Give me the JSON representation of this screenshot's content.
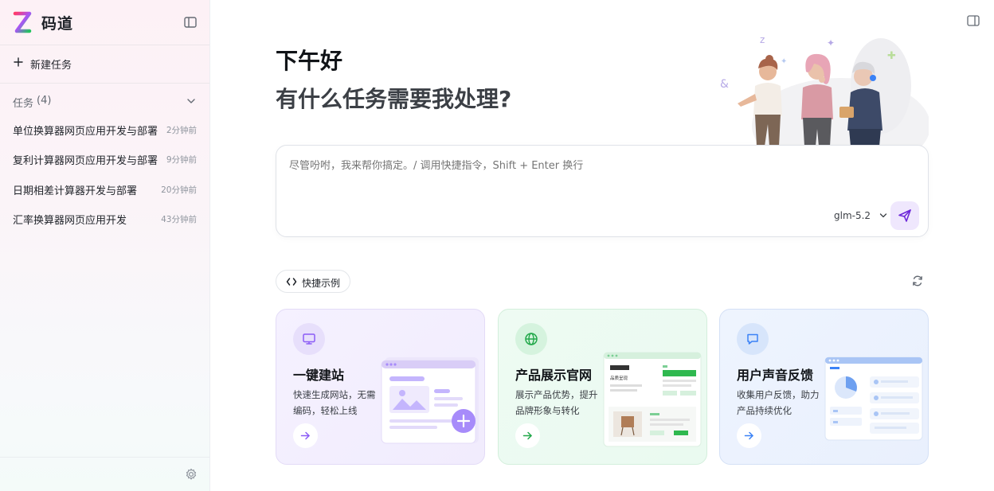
{
  "app": {
    "title": "码道"
  },
  "sidebar": {
    "new_task_label": "新建任务",
    "tasks_label": "任务",
    "tasks_count": "(4)",
    "tasks": [
      {
        "name": "单位换算器网页应用开发与部署",
        "time": "2分钟前"
      },
      {
        "name": "复利计算器网页应用开发与部署",
        "time": "9分钟前"
      },
      {
        "name": "日期相差计算器开发与部署",
        "time": "20分钟前"
      },
      {
        "name": "汇率换算器网页应用开发",
        "time": "43分钟前"
      }
    ]
  },
  "main": {
    "greeting": "下午好",
    "subtitle": "有什么任务需要我处理?",
    "input": {
      "placeholder": "尽管吩咐，我来帮你搞定。/ 调用快捷指令，Shift + Enter 换行",
      "model": "glm-5.2"
    },
    "examples_label": "快捷示例",
    "cards": [
      {
        "title": "一键建站",
        "desc": "快速生成网站，无需编码，轻松上线",
        "accent": "#8b5cf6",
        "icon": "monitor-icon"
      },
      {
        "title": "产品展示官网",
        "desc": "展示产品优势，提升品牌形象与转化",
        "accent": "#22a84a",
        "icon": "globe-icon"
      },
      {
        "title": "用户声音反馈",
        "desc": "收集用户反馈，助力产品持续优化",
        "accent": "#3b82f6",
        "icon": "chat-icon"
      }
    ]
  },
  "mockups": {
    "product_heading": "品质呈现"
  }
}
